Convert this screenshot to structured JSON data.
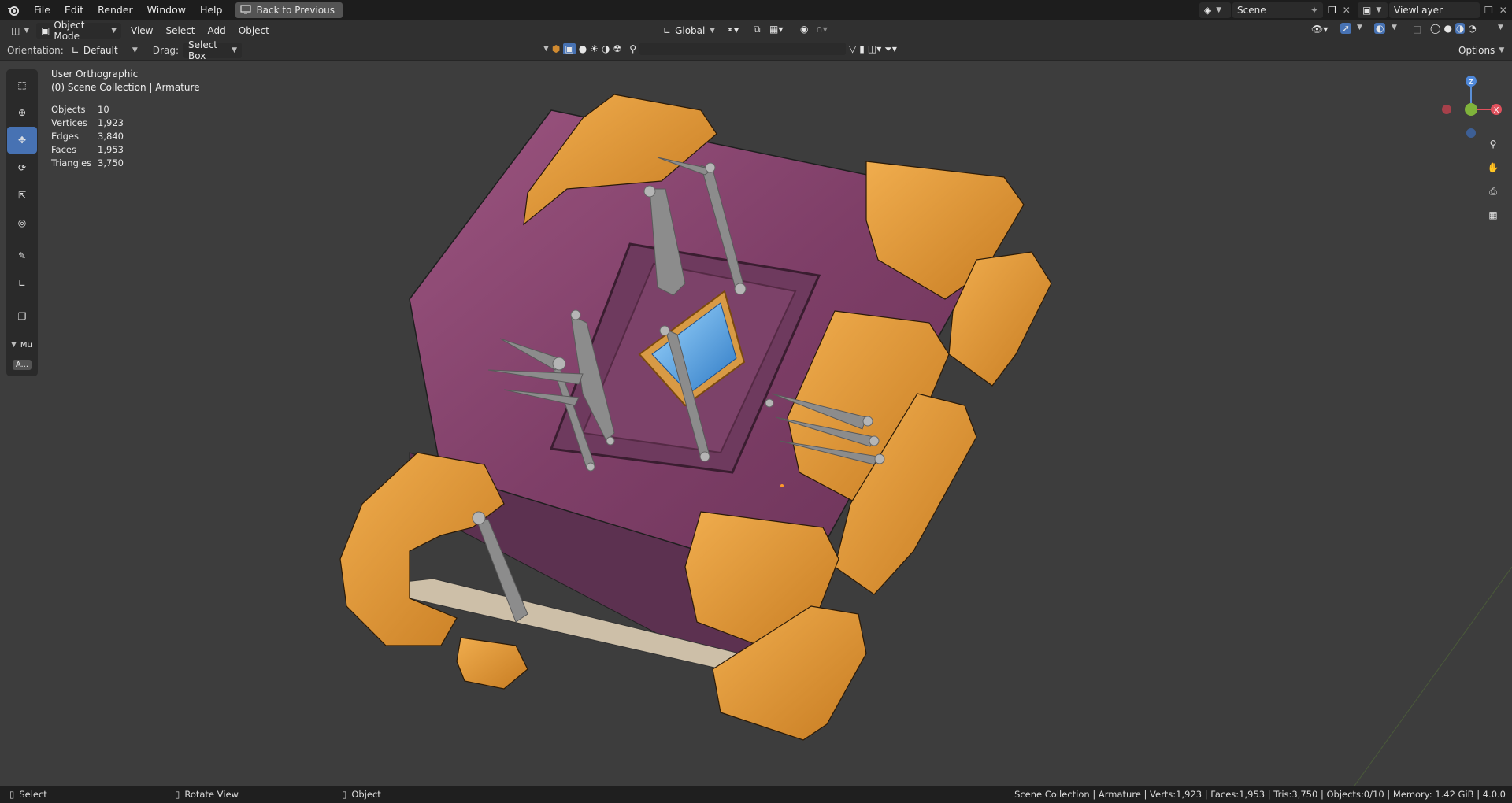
{
  "menubar": {
    "items": [
      "File",
      "Edit",
      "Render",
      "Window",
      "Help"
    ],
    "back_button": "Back to Previous",
    "scene": "Scene",
    "view_layer": "ViewLayer"
  },
  "header": {
    "mode": "Object Mode",
    "menus": [
      "View",
      "Select",
      "Add",
      "Object"
    ],
    "transform_orientation": "Global",
    "options": "Options"
  },
  "toolsettings": {
    "orientation_label": "Orientation:",
    "orientation_value": "Default",
    "drag_label": "Drag:",
    "drag_value": "Select Box"
  },
  "viewport": {
    "view_name": "User Orthographic",
    "collection": "(0) Scene Collection | Armature",
    "stats": [
      {
        "label": "Objects",
        "value": "10"
      },
      {
        "label": "Vertices",
        "value": "1,923"
      },
      {
        "label": "Edges",
        "value": "3,840"
      },
      {
        "label": "Faces",
        "value": "1,953"
      },
      {
        "label": "Triangles",
        "value": "3,750"
      }
    ],
    "panel_label": "Mu",
    "panel_button": "A...",
    "gizmo": {
      "z": "Z",
      "x": "X"
    }
  },
  "statusbar": {
    "select": "Select",
    "rotate": "Rotate View",
    "object": "Object",
    "info": "Scene Collection | Armature | Verts:1,923 | Faces:1,953 | Tris:3,750 | Objects:0/10 | Memory: 1.42 GiB | 4.0.0"
  },
  "colors": {
    "accent": "#4772b3",
    "book_leather": "#8a4470",
    "metal_corner": "#e39a3a",
    "gem": "#5aa8e0",
    "bones": "#8c8c8c"
  }
}
